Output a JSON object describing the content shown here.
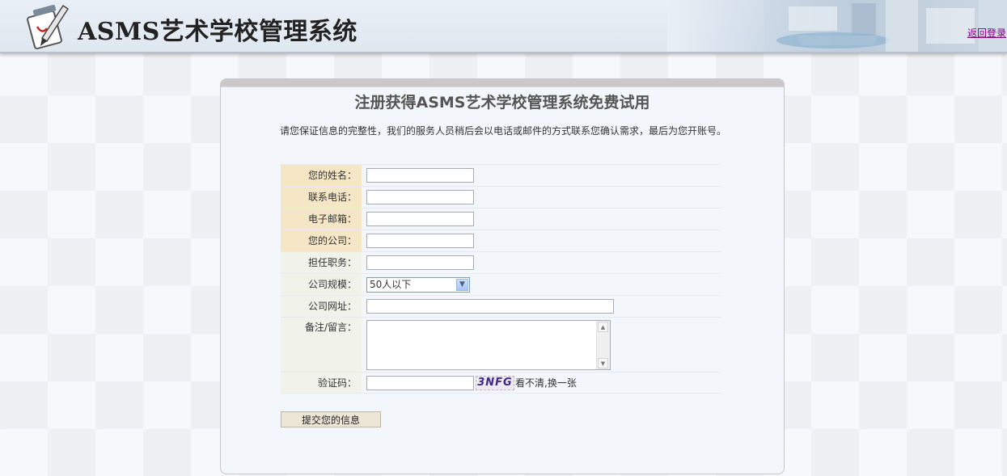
{
  "header": {
    "app_title": "ASMS艺术学校管理系统",
    "back_link": "返回登录"
  },
  "form": {
    "title": "注册获得ASMS艺术学校管理系统免费试用",
    "intro": "请您保证信息的完整性，我们的服务人员稍后会以电话或邮件的方式联系您确认需求，最后为您开账号。",
    "fields": {
      "name": {
        "label": "您的姓名：",
        "value": ""
      },
      "phone": {
        "label": "联系电话：",
        "value": ""
      },
      "email": {
        "label": "电子邮箱：",
        "value": ""
      },
      "company": {
        "label": "您的公司：",
        "value": ""
      },
      "position": {
        "label": "担任职务：",
        "value": ""
      },
      "scale": {
        "label": "公司规模：",
        "selected": "50人以下"
      },
      "website": {
        "label": "公司网址：",
        "value": ""
      },
      "remark": {
        "label": "备注/留言：",
        "value": ""
      },
      "captcha": {
        "label": "验证码：",
        "value": "",
        "image_text": "3NFG",
        "refresh_label": "看不清,换一张"
      }
    },
    "submit_label": "提交您的信息"
  },
  "colors": {
    "required_label_bg": "#f5e7c5",
    "optional_label_bg": "#f1f3ea",
    "panel_bg": "#f3f7fb",
    "link": "#800080"
  },
  "icons": {
    "logo": "notepad-pen-icon",
    "select_arrow": "chevron-down-icon",
    "scroll_up": "scroll-up-icon",
    "scroll_down": "scroll-down-icon"
  }
}
